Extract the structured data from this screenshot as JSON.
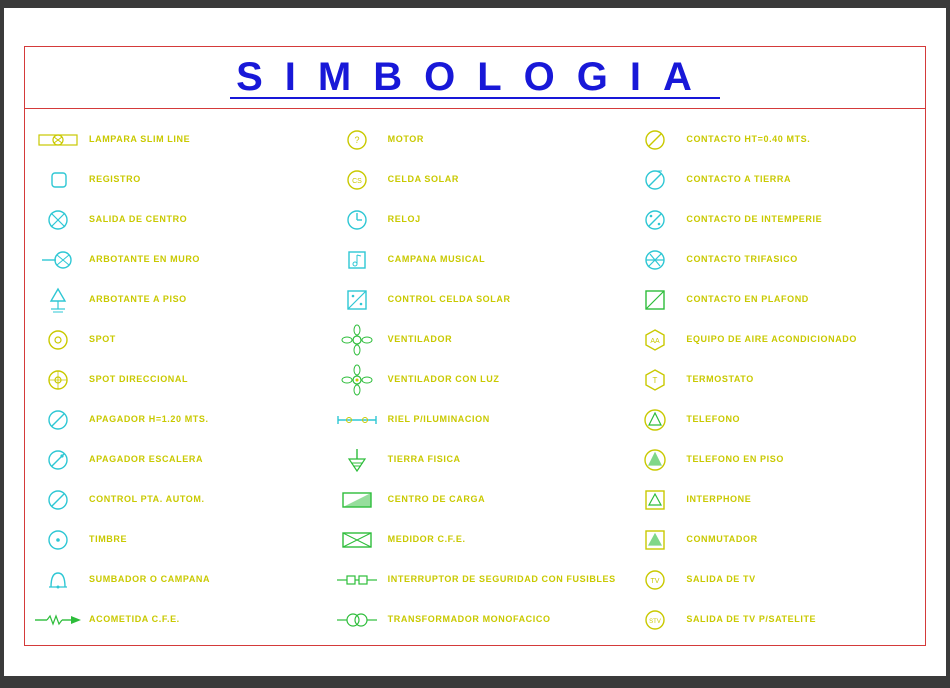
{
  "title": "SIMBOLOGIA",
  "columns": [
    [
      {
        "icon": "lamp-slim",
        "label": "LAMPARA SLIM LINE"
      },
      {
        "icon": "registro",
        "label": "REGISTRO"
      },
      {
        "icon": "salida-centro",
        "label": "SALIDA DE CENTRO"
      },
      {
        "icon": "arbotante-muro",
        "label": "ARBOTANTE EN MURO"
      },
      {
        "icon": "arbotante-piso",
        "label": "ARBOTANTE A PISO"
      },
      {
        "icon": "spot",
        "label": "SPOT"
      },
      {
        "icon": "spot-dir",
        "label": "SPOT DIRECCIONAL"
      },
      {
        "icon": "apagador",
        "label": "APAGADOR h=1.20 mts."
      },
      {
        "icon": "apagador-esc",
        "label": "APAGADOR ESCALERA"
      },
      {
        "icon": "control-pta",
        "label": "CONTROL PTA. AUTOM."
      },
      {
        "icon": "timbre",
        "label": "TIMBRE"
      },
      {
        "icon": "sumbador",
        "label": "SUMBADOR O CAMPANA"
      },
      {
        "icon": "acometida",
        "label": "ACOMETIDA C.F.E."
      }
    ],
    [
      {
        "icon": "motor",
        "label": "MOTOR"
      },
      {
        "icon": "celda-solar",
        "label": "CELDA SOLAR"
      },
      {
        "icon": "reloj",
        "label": "RELOJ"
      },
      {
        "icon": "campana-music",
        "label": "CAMPANA MUSICAL"
      },
      {
        "icon": "control-celda",
        "label": "CONTROL CELDA SOLAR"
      },
      {
        "icon": "ventilador",
        "label": "VENTILADOR"
      },
      {
        "icon": "ventilador-luz",
        "label": "VENTILADOR CON LUZ"
      },
      {
        "icon": "riel",
        "label": "RIEL P/ILUMINACION"
      },
      {
        "icon": "tierra",
        "label": "TIERRA FISICA"
      },
      {
        "icon": "centro-carga",
        "label": "CENTRO DE CARGA"
      },
      {
        "icon": "medidor",
        "label": "MEDIDOR C.F.E."
      },
      {
        "icon": "interruptor",
        "label": "INTERRUPTOR DE SEGURIDAD CON FUSIBLES"
      },
      {
        "icon": "transformador",
        "label": "TRANSFORMADOR MONOFACICO"
      }
    ],
    [
      {
        "icon": "contacto-ht",
        "label": "CONTACTO HT=0.40 mts."
      },
      {
        "icon": "contacto-tierra",
        "label": "CONTACTO A TIERRA"
      },
      {
        "icon": "contacto-intemp",
        "label": "CONTACTO DE INTEMPERIE"
      },
      {
        "icon": "contacto-trif",
        "label": "CONTACTO TRIFASICO"
      },
      {
        "icon": "contacto-plafond",
        "label": "CONTACTO EN PLAFOND"
      },
      {
        "icon": "aire-acond",
        "label": "EQUIPO DE AIRE ACONDICIONADO"
      },
      {
        "icon": "termostato",
        "label": "TERMOSTATO"
      },
      {
        "icon": "telefono",
        "label": "TELEFONO"
      },
      {
        "icon": "telefono-piso",
        "label": "TELEFONO EN PISO"
      },
      {
        "icon": "interphone",
        "label": "INTERPHONE"
      },
      {
        "icon": "conmutador",
        "label": "CONMUTADOR"
      },
      {
        "icon": "salida-tv",
        "label": "SALIDA DE TV"
      },
      {
        "icon": "salida-tv-sat",
        "label": "SALIDA DE TV P/SATELITE"
      }
    ]
  ]
}
